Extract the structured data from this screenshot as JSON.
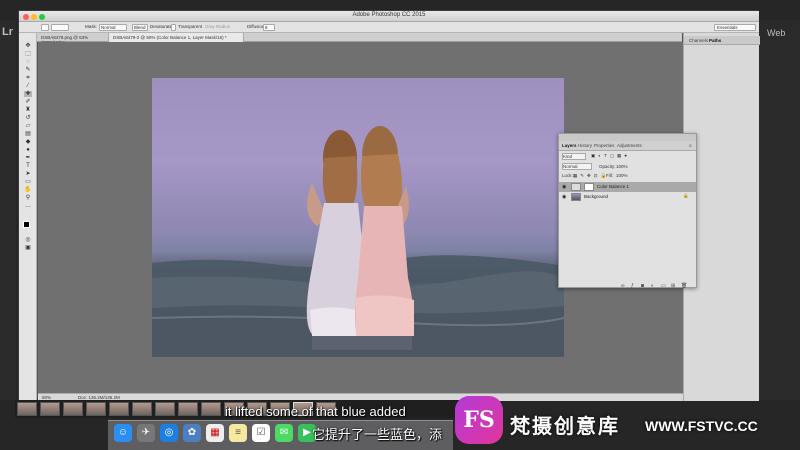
{
  "lightroom": {
    "logo_text": "Lr",
    "web_label": "Web"
  },
  "photoshop": {
    "window_title": "Adobe Photoshop CC 2015",
    "options_bar": {
      "mask_label": "Mask:",
      "mask_value": "Normal",
      "blend_label": "Blend",
      "desaturate_label": "Desaturate",
      "transparent_label": "Transparent",
      "subtract_label": "Gray Radius",
      "diffusion_label": "Diffusion",
      "diffusion_value": "8",
      "workspace": "Essentials"
    },
    "tabs": [
      {
        "label": "DSBA8479.png @ 53% (RGB/16*) *",
        "active": false
      },
      {
        "label": "DSBA8479-2 @ 50% (Color Balance 1, Layer Mask/16) *",
        "active": true
      }
    ],
    "status_bar": {
      "zoom": "50%",
      "doc": "Doc: 136.2M/136.2M"
    },
    "right_panel_tabs": [
      "Channels",
      "Paths"
    ]
  },
  "layers_panel": {
    "tabs": [
      "Layers",
      "History",
      "Properties",
      "Adjustments"
    ],
    "active_tab": "Layers",
    "kind_label": "Kind",
    "blend_mode": "Normal",
    "opacity_label": "Opacity:",
    "opacity_value": "100%",
    "lock_label": "Lock:",
    "fill_label": "Fill:",
    "fill_value": "100%",
    "layers": [
      {
        "name": "Color Balance 1",
        "selected": true
      },
      {
        "name": "Background",
        "selected": false
      }
    ]
  },
  "subtitles": {
    "english": "it lifted some of that blue added",
    "chinese": "它提升了一些蓝色，添"
  },
  "watermark": {
    "logo": "FS",
    "brand_cn": "梵摄创意库",
    "url": "WWW.FSTVC.CC"
  },
  "colors": {
    "sky": "#a597c6",
    "sea": "#4d5a66",
    "watermark_accent": "#c83ac0"
  },
  "dock_icons": [
    "finder-icon",
    "launchpad-icon",
    "safari-icon",
    "photos-icon",
    "calendar-icon",
    "preview-icon",
    "notes-icon",
    "reminders-icon",
    "messages-icon",
    "facetime-icon",
    "itunes-icon",
    "ibooks-icon",
    "app-store-icon"
  ]
}
